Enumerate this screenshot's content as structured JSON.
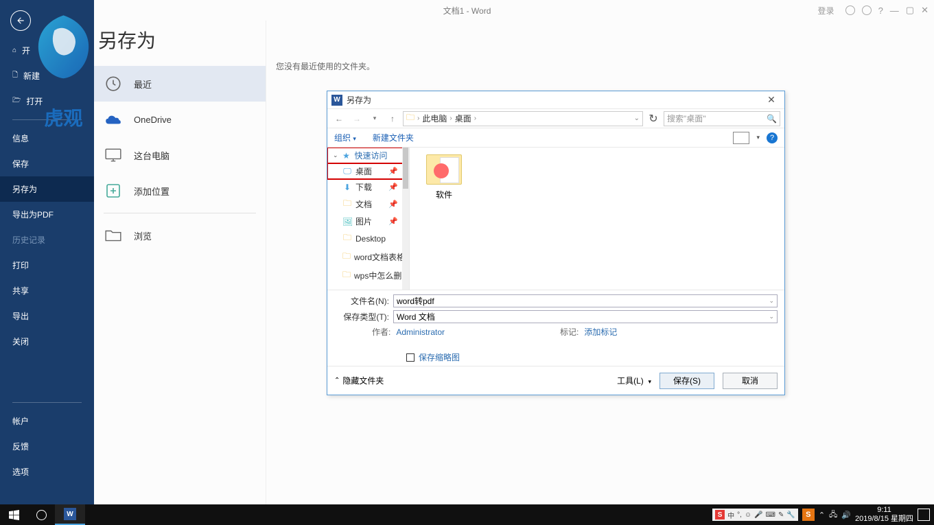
{
  "titlebar": {
    "document_title": "文档1  -  Word",
    "login_label": "登录",
    "help_glyph": "?"
  },
  "sidebar": {
    "home_label": "开",
    "new_label": "新建",
    "open_label": "打开",
    "info_label": "信息",
    "save_label": "保存",
    "saveas_label": "另存为",
    "export_pdf_label": "导出为PDF",
    "history_label": "历史记录",
    "print_label": "打印",
    "share_label": "共享",
    "export_label": "导出",
    "close_label": "关闭",
    "account_label": "帐户",
    "feedback_label": "反馈",
    "options_label": "选项"
  },
  "page": {
    "title": "另存为",
    "recent_msg": "您没有最近使用的文件夹。",
    "locations": {
      "recent_label": "最近",
      "onedrive_label": "OneDrive",
      "thispc_label": "这台电脑",
      "addplace_label": "添加位置",
      "browse_label": "浏览"
    }
  },
  "dialog": {
    "title": "另存为",
    "breadcrumb": {
      "thispc": "此电脑",
      "desktop": "桌面"
    },
    "search_placeholder": "搜索\"桌面\"",
    "toolbar": {
      "organize": "组织",
      "newfolder": "新建文件夹"
    },
    "tree": {
      "quick_access": "快速访问",
      "desktop": "桌面",
      "downloads": "下载",
      "documents": "文档",
      "pictures": "图片",
      "desktop_en": "Desktop",
      "word_table": "word文档表格怎",
      "wps_delete": "wps中怎么删除空"
    },
    "file_tile": {
      "name": "软件"
    },
    "fields": {
      "filename_label": "文件名(N):",
      "filename_value": "word转pdf",
      "savetype_label": "保存类型(T):",
      "savetype_value": "Word 文档",
      "author_label": "作者:",
      "author_value": "Administrator",
      "tag_label": "标记:",
      "tag_value": "添加标记",
      "thumb_label": "保存缩略图"
    },
    "footer": {
      "hide_folders": "隐藏文件夹",
      "tools": "工具(L)",
      "save": "保存(S)",
      "cancel": "取消"
    }
  },
  "ime": {
    "mode": "中"
  },
  "taskbar": {
    "time": "9:11",
    "date": "2019/8/15 星期四"
  },
  "watermark": {
    "text": "虎观"
  }
}
